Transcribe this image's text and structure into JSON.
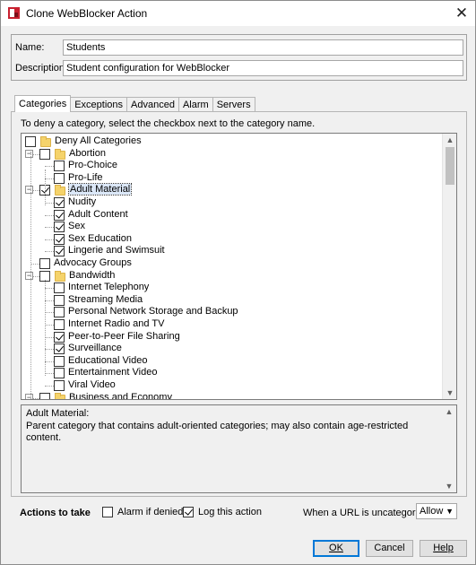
{
  "window": {
    "title": "Clone WebBlocker Action",
    "close_glyph": "✕",
    "app_icon": "webblocker-app-icon"
  },
  "form": {
    "name_label": "Name:",
    "name_value": "Students",
    "description_label": "Description:",
    "description_value": "Student configuration for WebBlocker"
  },
  "tabs": [
    {
      "label": "Categories",
      "active": true
    },
    {
      "label": "Exceptions",
      "active": false
    },
    {
      "label": "Advanced",
      "active": false
    },
    {
      "label": "Alarm",
      "active": false
    },
    {
      "label": "Servers",
      "active": false
    }
  ],
  "categories": {
    "instruction": "To deny a category, select the checkbox next to the category name.",
    "tree": [
      {
        "label": "Deny All Categories",
        "level": 0,
        "checked": false,
        "folder": true,
        "expander": ""
      },
      {
        "label": "Abortion",
        "level": 1,
        "checked": false,
        "folder": true,
        "expander": "−"
      },
      {
        "label": "Pro-Choice",
        "level": 2,
        "checked": false,
        "folder": false,
        "expander": ""
      },
      {
        "label": "Pro-Life",
        "level": 2,
        "checked": false,
        "folder": false,
        "expander": ""
      },
      {
        "label": "Adult Material",
        "level": 1,
        "checked": true,
        "folder": true,
        "expander": "−",
        "selected": true
      },
      {
        "label": "Nudity",
        "level": 2,
        "checked": true,
        "folder": false,
        "expander": ""
      },
      {
        "label": "Adult Content",
        "level": 2,
        "checked": true,
        "folder": false,
        "expander": ""
      },
      {
        "label": "Sex",
        "level": 2,
        "checked": true,
        "folder": false,
        "expander": ""
      },
      {
        "label": "Sex Education",
        "level": 2,
        "checked": true,
        "folder": false,
        "expander": ""
      },
      {
        "label": "Lingerie and Swimsuit",
        "level": 2,
        "checked": true,
        "folder": false,
        "expander": ""
      },
      {
        "label": "Advocacy Groups",
        "level": 1,
        "checked": false,
        "folder": false,
        "expander": ""
      },
      {
        "label": "Bandwidth",
        "level": 1,
        "checked": false,
        "folder": true,
        "expander": "−"
      },
      {
        "label": "Internet Telephony",
        "level": 2,
        "checked": false,
        "folder": false,
        "expander": ""
      },
      {
        "label": "Streaming Media",
        "level": 2,
        "checked": false,
        "folder": false,
        "expander": ""
      },
      {
        "label": "Personal Network Storage and Backup",
        "level": 2,
        "checked": false,
        "folder": false,
        "expander": ""
      },
      {
        "label": "Internet Radio and TV",
        "level": 2,
        "checked": false,
        "folder": false,
        "expander": ""
      },
      {
        "label": "Peer-to-Peer File Sharing",
        "level": 2,
        "checked": true,
        "folder": false,
        "expander": ""
      },
      {
        "label": "Surveillance",
        "level": 2,
        "checked": true,
        "folder": false,
        "expander": ""
      },
      {
        "label": "Educational Video",
        "level": 2,
        "checked": false,
        "folder": false,
        "expander": ""
      },
      {
        "label": "Entertainment Video",
        "level": 2,
        "checked": false,
        "folder": false,
        "expander": ""
      },
      {
        "label": "Viral Video",
        "level": 2,
        "checked": false,
        "folder": false,
        "expander": ""
      },
      {
        "label": "Business and Economy",
        "level": 1,
        "checked": false,
        "folder": true,
        "expander": "−"
      }
    ],
    "description_title": "Adult Material:",
    "description_text": "Parent category that contains adult-oriented categories; may also contain age-restricted content."
  },
  "actions": {
    "label": "Actions to take",
    "alarm_label": "Alarm if denied",
    "alarm_checked": false,
    "log_label": "Log this action",
    "log_checked": true,
    "uncategorized_label": "When a URL is uncategorized",
    "uncategorized_value": "Allow"
  },
  "buttons": {
    "ok": "OK",
    "cancel": "Cancel",
    "help": "Help"
  },
  "colors": {
    "folder": "#f5d36b",
    "default_button_border": "#0078d7",
    "selection": "#dbe7f7"
  }
}
